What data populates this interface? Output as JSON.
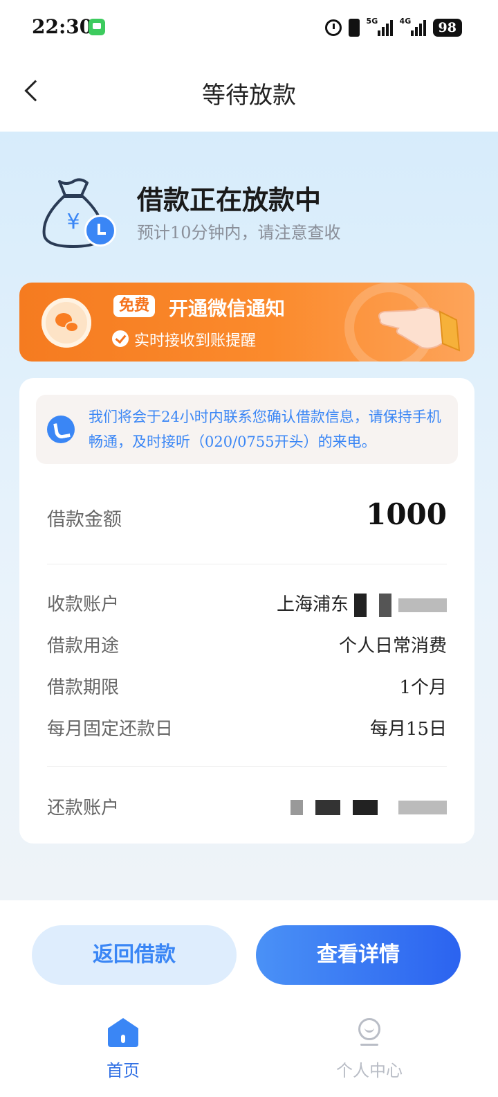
{
  "status_bar": {
    "time": "22:30",
    "network_1": "5G",
    "network_2": "4G",
    "battery": "98"
  },
  "nav": {
    "title": "等待放款"
  },
  "status": {
    "title": "借款正在放款中",
    "subtitle": "预计10分钟内，请注意查收"
  },
  "wechat_banner": {
    "tag": "免费",
    "title": "开通微信通知",
    "subtitle": "实时接收到账提醒"
  },
  "notice": {
    "text": "我们将会于24小时内联系您确认借款信息，请保持手机畅通，及时接听（020/0755开头）的来电。"
  },
  "loan": {
    "amount_label": "借款金额",
    "amount_value": "1000",
    "receive_account_label": "收款账户",
    "receive_account_value": "上海浦东",
    "purpose_label": "借款用途",
    "purpose_value": "个人日常消费",
    "term_label": "借款期限",
    "term_value": "1个月",
    "repay_day_label": "每月固定还款日",
    "repay_day_value": "每月15日",
    "repay_account_label": "还款账户"
  },
  "actions": {
    "back_label": "返回借款",
    "detail_label": "查看详情"
  },
  "tabbar": {
    "home_label": "首页",
    "me_label": "个人中心"
  },
  "colors": {
    "primary": "#3a86f5",
    "banner_orange": "#f57b20",
    "background_top": "#d7ecfb"
  }
}
